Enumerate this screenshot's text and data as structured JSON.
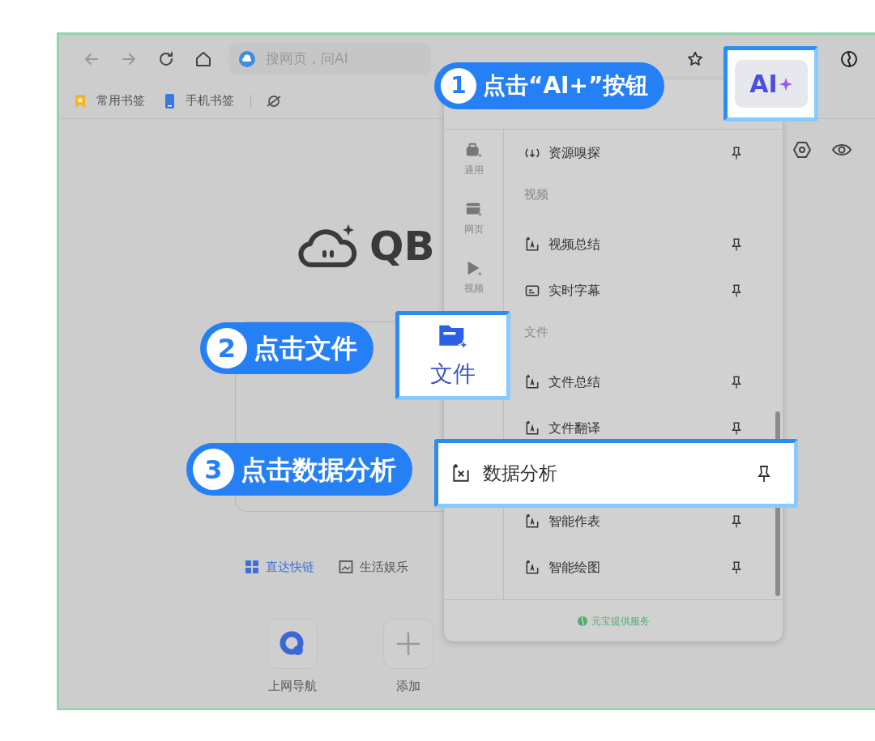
{
  "address_bar": {
    "placeholder": "搜网页，问AI"
  },
  "ai_button": {
    "label": "AI",
    "highlighted": true
  },
  "bookmarks": [
    {
      "label": "常用书签"
    },
    {
      "label": "手机书签"
    }
  ],
  "logo": {
    "text": "QB"
  },
  "tabs": [
    {
      "label": "直达快链",
      "selected": true
    },
    {
      "label": "生活娱乐",
      "selected": false
    }
  ],
  "shortcuts": [
    {
      "label": "上网导航",
      "kind": "app"
    },
    {
      "label": "添加",
      "kind": "add"
    }
  ],
  "ai_panel": {
    "rail": [
      {
        "label": "通用",
        "highlighted": false
      },
      {
        "label": "网页",
        "highlighted": false
      },
      {
        "label": "视频",
        "highlighted": false
      },
      {
        "label": "文件",
        "highlighted": true
      }
    ],
    "sections": [
      {
        "items": [
          {
            "label": "资源嗅探",
            "highlighted": false
          }
        ]
      },
      {
        "title": "视频",
        "items": [
          {
            "label": "视频总结",
            "highlighted": false
          },
          {
            "label": "实时字幕",
            "highlighted": false
          }
        ]
      },
      {
        "title": "文件",
        "items": [
          {
            "label": "文件总结",
            "highlighted": false
          },
          {
            "label": "文件翻译",
            "highlighted": false
          },
          {
            "label": "数据分析",
            "highlighted": true
          },
          {
            "label": "智能作表",
            "highlighted": false
          },
          {
            "label": "智能绘图",
            "highlighted": false
          }
        ]
      }
    ],
    "footer": "元宝提供服务"
  },
  "callouts": [
    {
      "number": "1",
      "text": "点击“AI+”按钮"
    },
    {
      "number": "2",
      "text": "点击文件"
    },
    {
      "number": "3",
      "text": "点击数据分析"
    }
  ]
}
